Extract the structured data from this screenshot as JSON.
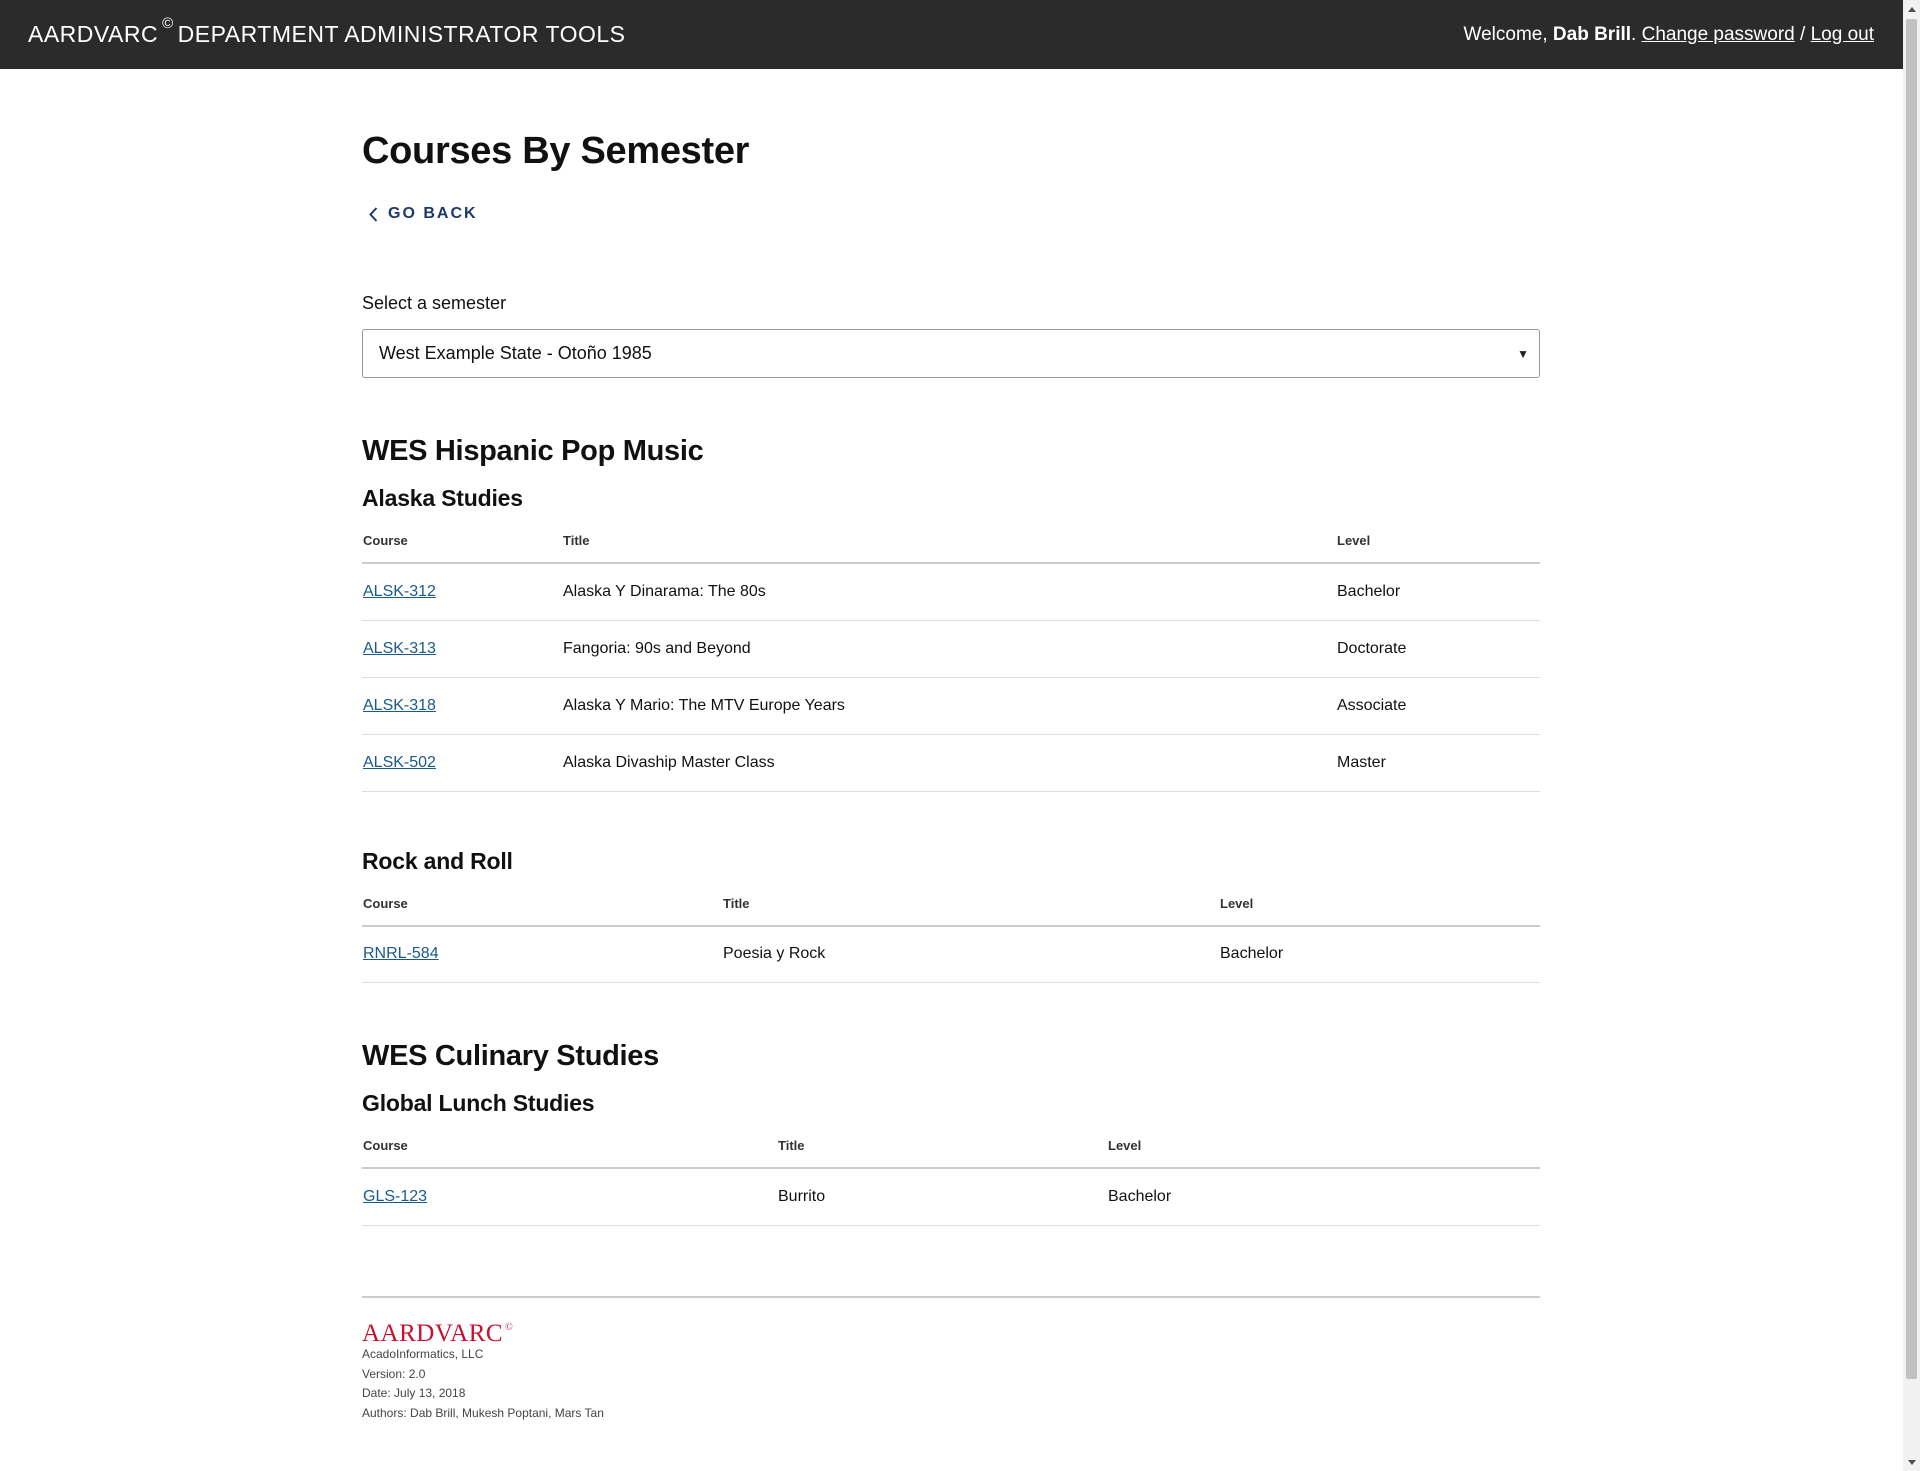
{
  "header": {
    "brand": "AARDVARC",
    "brand_symbol": "©",
    "brand_suffix": "DEPARTMENT ADMINISTRATOR TOOLS",
    "welcome_prefix": "Welcome,",
    "user_name": "Dab Brill",
    "change_password": "Change password",
    "separator": "/",
    "logout": "Log out"
  },
  "page": {
    "title": "Courses By Semester",
    "go_back": "GO BACK",
    "select_label": "Select a semester",
    "selected_semester": "West Example State - Otoño 1985"
  },
  "departments": [
    {
      "name": "WES Hispanic Pop Music",
      "subjects": [
        {
          "name": "Alaska Studies",
          "columns": [
            "Course",
            "Title",
            "Level"
          ],
          "rows": [
            {
              "course": "ALSK-312",
              "title": "Alaska Y Dinarama: The 80s",
              "level": "Bachelor"
            },
            {
              "course": "ALSK-313",
              "title": "Fangoria: 90s and Beyond",
              "level": "Doctorate"
            },
            {
              "course": "ALSK-318",
              "title": "Alaska Y Mario: The MTV Europe Years",
              "level": "Associate"
            },
            {
              "course": "ALSK-502",
              "title": "Alaska Divaship Master Class",
              "level": "Master"
            }
          ]
        },
        {
          "name": "Rock and Roll",
          "columns": [
            "Course",
            "Title",
            "Level"
          ],
          "rows": [
            {
              "course": "RNRL-584",
              "title": "Poesia y Rock",
              "level": "Bachelor"
            }
          ]
        }
      ]
    },
    {
      "name": "WES Culinary Studies",
      "subjects": [
        {
          "name": "Global Lunch Studies",
          "columns": [
            "Course",
            "Title",
            "Level"
          ],
          "rows": [
            {
              "course": "GLS-123",
              "title": "Burrito",
              "level": "Bachelor"
            }
          ]
        }
      ]
    }
  ],
  "footer": {
    "logo": "AARDVARC",
    "logo_symbol": "©",
    "company": "AcadoInformatics, LLC",
    "version": "Version: 2.0",
    "date": "Date: July 13, 2018",
    "authors": "Authors: Dab Brill, Mukesh Poptani, Mars Tan"
  },
  "colors": {
    "topbar_bg": "#2b2b2b",
    "link": "#1a5a8a",
    "go_back": "#1a3a6b",
    "footer_logo": "#c8102e"
  }
}
